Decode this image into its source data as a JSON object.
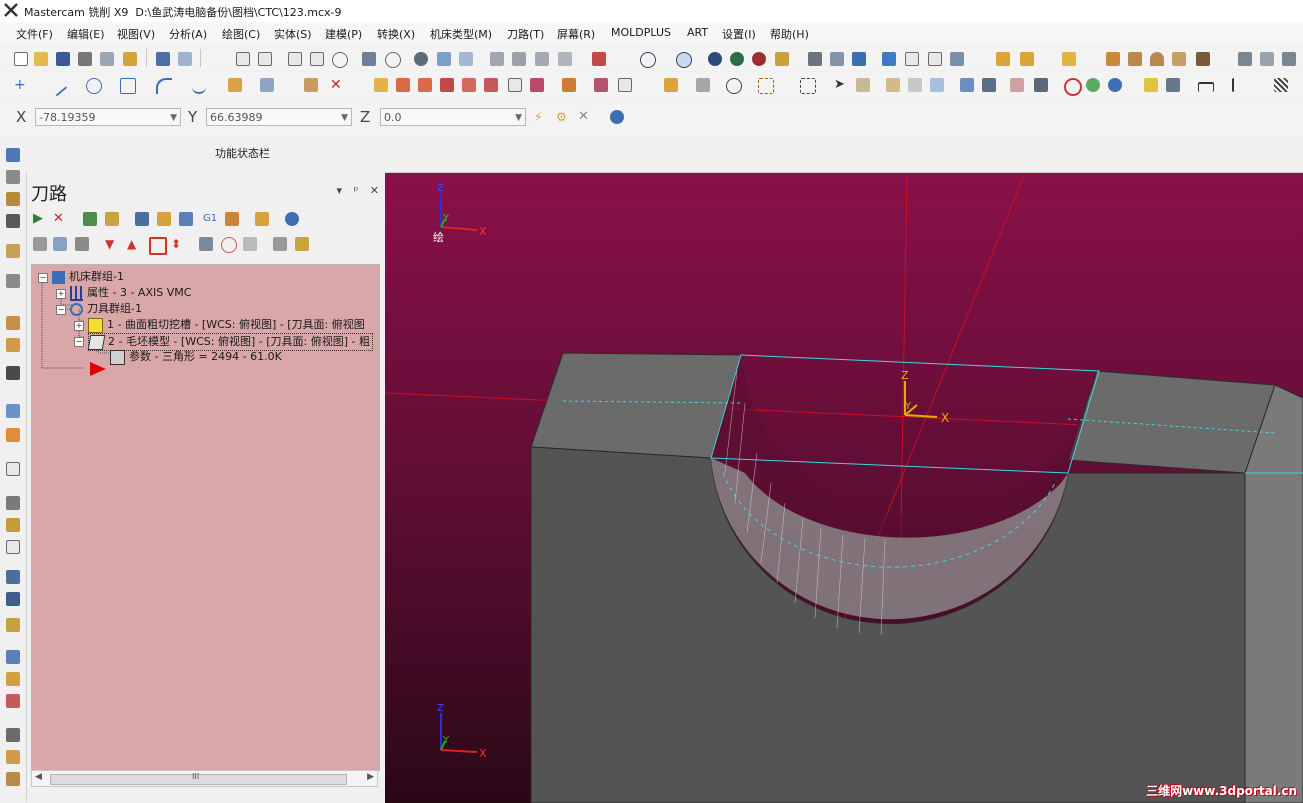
{
  "window": {
    "app_title": "Mastercam 铣削 X9",
    "file_path": "D:\\鱼武涛电脑备份\\图档\\CTC\\123.mcx-9"
  },
  "menu": [
    "文件(F)",
    "编辑(E)",
    "视图(V)",
    "分析(A)",
    "绘图(C)",
    "实体(S)",
    "建模(P)",
    "转换(X)",
    "机床类型(M)",
    "刀路(T)",
    "屏幕(R)",
    "MOLDPLUS",
    "ART",
    "设置(I)",
    "帮助(H)"
  ],
  "coords": {
    "x_label": "X",
    "x_value": "-78.19359",
    "y_label": "Y",
    "y_value": "66.63989",
    "z_label": "Z",
    "z_value": "0.0"
  },
  "status_label": "功能状态栏",
  "panel": {
    "title": "刀路",
    "controls": [
      "▾",
      "ᵖ",
      "✕"
    ],
    "tree": [
      {
        "label": "机床群组-1"
      },
      {
        "label": "属性 - 3 - AXIS VMC"
      },
      {
        "label": "刀具群组-1"
      },
      {
        "label": "1 - 曲面粗切挖槽 - [WCS: 俯视图] - [刀具面: 俯视图"
      },
      {
        "label": "2 - 毛坯模型 - [WCS: 俯视图] - [刀具面: 俯视图] - 粗"
      },
      {
        "label": "参数 - 三角形 =  2494 - 61.0K"
      }
    ],
    "scroll_thumb_label": "III"
  },
  "viewport": {
    "top_axis": {
      "z": "Z",
      "y": "Y",
      "x": "X",
      "view_label": "绘"
    },
    "origin_axis": {
      "z": "Z",
      "y": "Y",
      "x": "X"
    },
    "bottom_axis": {
      "z": "Z",
      "y": "Y",
      "x": "X"
    },
    "watermark": "三维网www.3dportal.cn"
  },
  "colors": {
    "viewport_top": "#8a1049",
    "viewport_bottom": "#2a0816",
    "tree_bg": "#d9a7a7",
    "axis_red": "#d40000",
    "selection_cyan": "#3fd6e0"
  }
}
